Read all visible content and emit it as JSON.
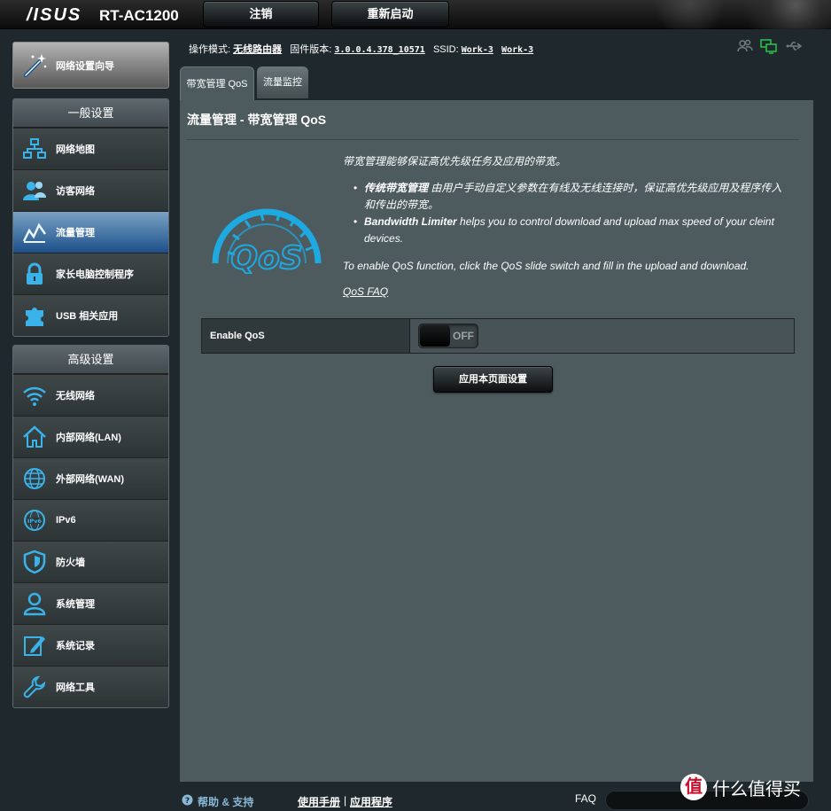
{
  "banner": {
    "brand": "/ISUS",
    "model": "RT-AC1200",
    "logout_label": "注销",
    "reboot_label": "重新启动"
  },
  "status": {
    "mode_label": "操作模式:",
    "mode_value": "无线路由器",
    "firmware_label": "固件版本:",
    "firmware_value": "3.0.0.4.378_10571",
    "ssid_label": "SSID:",
    "ssid_1": "Work-3",
    "ssid_2": "Work-3"
  },
  "sidebar": {
    "wizard_label": "网络设置向导",
    "general_title": "一般设置",
    "general_items": [
      {
        "label": "网络地图",
        "icon": "network-map-icon"
      },
      {
        "label": "访客网络",
        "icon": "guest-network-icon"
      },
      {
        "label": "流量管理",
        "icon": "traffic-manager-icon",
        "active": true
      },
      {
        "label": "家长电脑控制程序",
        "icon": "parental-control-icon"
      },
      {
        "label": "USB 相关应用",
        "icon": "usb-app-icon"
      }
    ],
    "advanced_title": "高级设置",
    "advanced_items": [
      {
        "label": "无线网络",
        "icon": "wireless-icon"
      },
      {
        "label": "内部网络(LAN)",
        "icon": "lan-icon"
      },
      {
        "label": "外部网络(WAN)",
        "icon": "wan-icon"
      },
      {
        "label": "IPv6",
        "icon": "ipv6-icon"
      },
      {
        "label": "防火墙",
        "icon": "firewall-icon"
      },
      {
        "label": "系统管理",
        "icon": "administration-icon"
      },
      {
        "label": "系统记录",
        "icon": "system-log-icon"
      },
      {
        "label": "网络工具",
        "icon": "network-tools-icon"
      }
    ]
  },
  "tabs": {
    "qos": "带宽管理 QoS",
    "monitor": "流量监控"
  },
  "main": {
    "title": "流量管理 - 带宽管理 QoS",
    "intro": "带宽管理能够保证高优先级任务及应用的带宽。",
    "bullet1_bold": "传统带宽管理",
    "bullet1_text": "由用户手动自定义参数在有线及无线连接时，保证高优先级应用及程序传入和传出的带宽。",
    "bullet2_bold": "Bandwidth Limiter",
    "bullet2_text": "helps you to control download and upload max speed of your cleint devices.",
    "enable_note": "To enable QoS function, click the QoS slide switch and fill in the upload and download.",
    "faq_link": "QoS FAQ",
    "logo_text": "QoS",
    "enable_label": "Enable QoS",
    "switch_state": "OFF",
    "apply_label": "应用本页面设置"
  },
  "footer": {
    "help": "帮助 & 支持",
    "manual": "使用手册",
    "separator": "|",
    "app": "应用程序",
    "faq_label": "FAQ",
    "faq_placeholder": ""
  },
  "watermark": {
    "badge": "值",
    "text": "什么值得买"
  },
  "colors": {
    "panel": "#4d5a5e",
    "active_nav": "#4b7aa8",
    "qos_logo": "#1fa9e1"
  }
}
